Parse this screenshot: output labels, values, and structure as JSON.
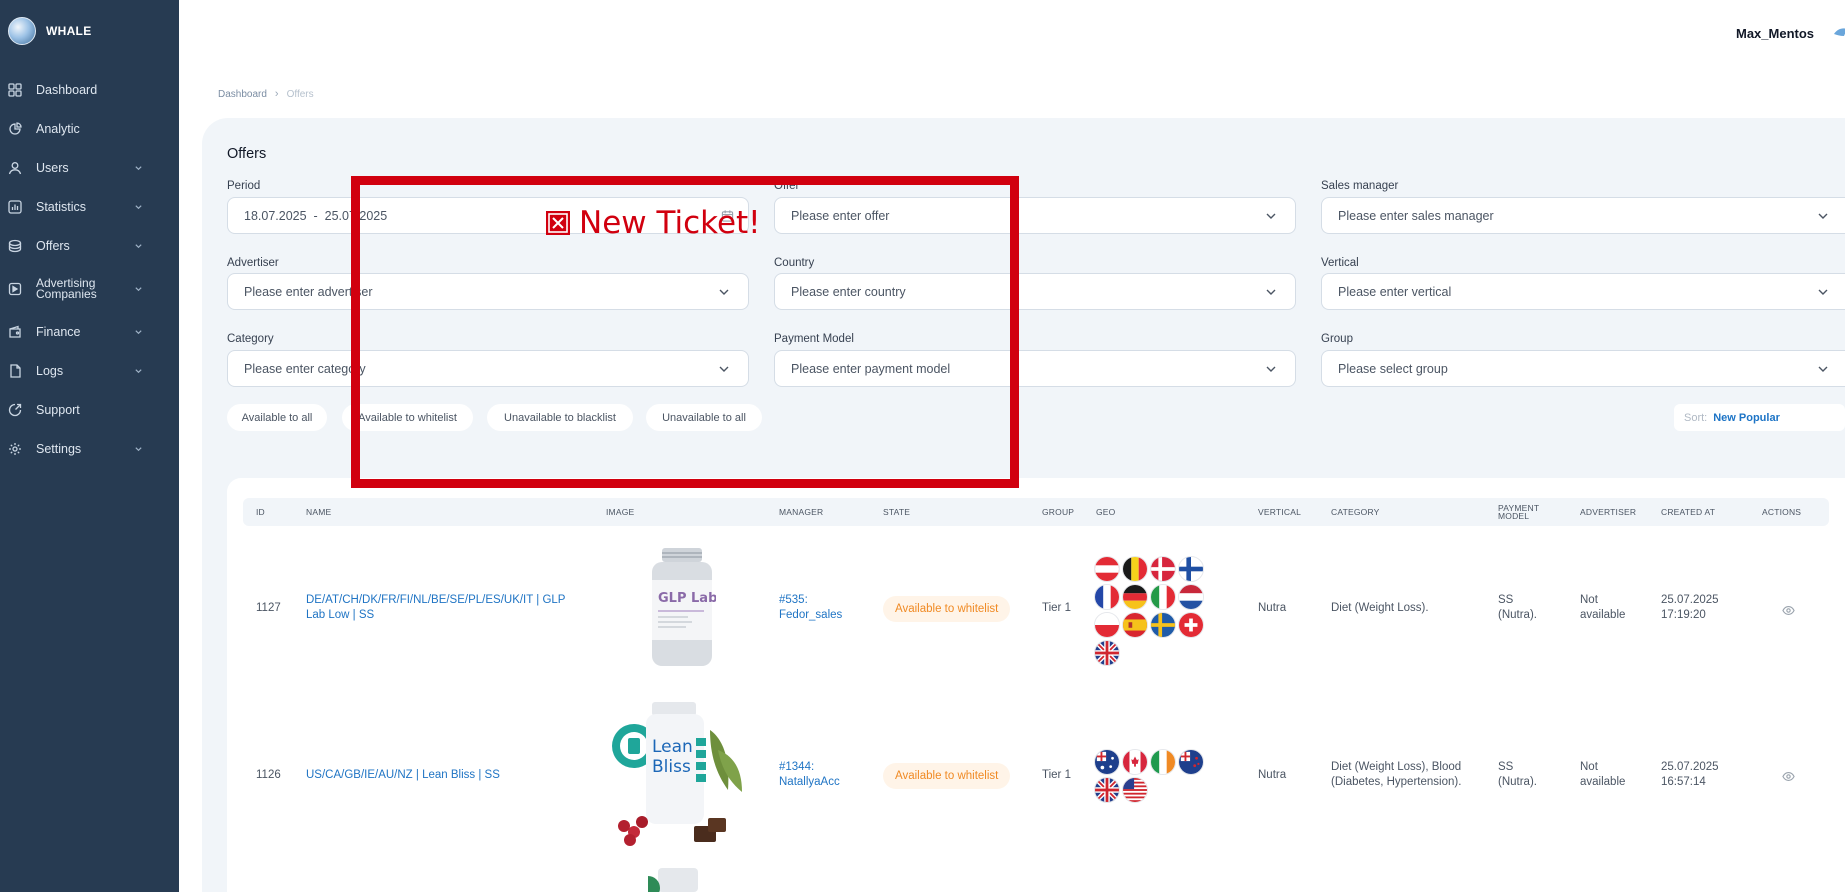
{
  "app": {
    "brand": "WHALE"
  },
  "sidebar": {
    "items": [
      {
        "label": "Dashboard",
        "icon": "dashboard-icon",
        "has_chevron": false
      },
      {
        "label": "Analytic",
        "icon": "analytic-icon",
        "has_chevron": false
      },
      {
        "label": "Users",
        "icon": "user-icon",
        "has_chevron": true
      },
      {
        "label": "Statistics",
        "icon": "statistics-icon",
        "has_chevron": true
      },
      {
        "label": "Offers",
        "icon": "offers-icon",
        "has_chevron": true
      },
      {
        "label": "Advertising Companies",
        "icon": "advertising-icon",
        "has_chevron": true
      },
      {
        "label": "Finance",
        "icon": "finance-icon",
        "has_chevron": true
      },
      {
        "label": "Logs",
        "icon": "logs-icon",
        "has_chevron": true
      },
      {
        "label": "Support",
        "icon": "support-icon",
        "has_chevron": false
      },
      {
        "label": "Settings",
        "icon": "settings-icon",
        "has_chevron": true
      }
    ]
  },
  "header": {
    "user_name": "Max_Mentos",
    "avatar_icon": "whale-avatar-icon"
  },
  "breadcrumb": {
    "items": [
      "Dashboard",
      "Offers"
    ]
  },
  "page": {
    "title": "Offers"
  },
  "filters": {
    "period": {
      "label": "Period",
      "value": "18.07.2025  -  25.07.2025"
    },
    "offer": {
      "label": "Offer",
      "placeholder": "Please enter offer"
    },
    "sales_manager": {
      "label": "Sales manager",
      "placeholder": "Please enter sales manager"
    },
    "advertiser": {
      "label": "Advertiser",
      "placeholder": "Please enter advertiser"
    },
    "country": {
      "label": "Country",
      "placeholder": "Please enter country"
    },
    "vertical": {
      "label": "Vertical",
      "placeholder": "Please enter vertical"
    },
    "category": {
      "label": "Category",
      "placeholder": "Please enter category"
    },
    "payment_model": {
      "label": "Payment Model",
      "placeholder": "Please enter payment model"
    },
    "group": {
      "label": "Group",
      "placeholder": "Please select group"
    }
  },
  "availability_chips": [
    "Available to all",
    "Available to whitelist",
    "Unavailable to blacklist",
    "Unavailable to all"
  ],
  "sort": {
    "label": "Sort:",
    "value": "New Popular"
  },
  "table": {
    "columns": [
      "ID",
      "NAME",
      "IMAGE",
      "MANAGER",
      "STATE",
      "GROUP",
      "GEO",
      "VERTICAL",
      "CATEGORY",
      "PAYMENT MODEL",
      "ADVERTISER",
      "CREATED AT",
      "ACTIONS"
    ],
    "rows": [
      {
        "id": "1127",
        "name": "DE/AT/CH/DK/FR/FI/NL/BE/SE/PL/ES/UK/IT | GLP Lab Low | SS",
        "image_label": "GLP Lab",
        "manager": "#535: Fedor_sales",
        "state": "Available to whitelist",
        "group": "Tier 1",
        "geo": [
          "AT",
          "BE",
          "DK",
          "FI",
          "FR",
          "DE",
          "IT",
          "NL",
          "PL",
          "ES",
          "SE",
          "CH",
          "UK"
        ],
        "vertical": "Nutra",
        "category": "Diet (Weight Loss).",
        "payment_model": "SS (Nutra).",
        "advertiser": "Not available",
        "created_at": "25.07.2025 17:19:20"
      },
      {
        "id": "1126",
        "name": "US/CA/GB/IE/AU/NZ | Lean Bliss | SS",
        "image_label": "Lean Bliss",
        "manager": "#1344: NatallyaAcc",
        "state": "Available to whitelist",
        "group": "Tier 1",
        "geo": [
          "AU",
          "CA",
          "IE",
          "NZ",
          "GB",
          "US"
        ],
        "vertical": "Nutra",
        "category": "Diet (Weight Loss), Blood (Diabetes, Hypertension).",
        "payment_model": "SS (Nutra).",
        "advertiser": "Not available",
        "created_at": "25.07.2025 16:57:14"
      }
    ]
  },
  "overlay": {
    "text": "New Ticket!",
    "color": "#d1000f"
  },
  "colors": {
    "sidebar": "#273b52",
    "accent": "#1f74c4",
    "state_badge": "#f08a24"
  }
}
